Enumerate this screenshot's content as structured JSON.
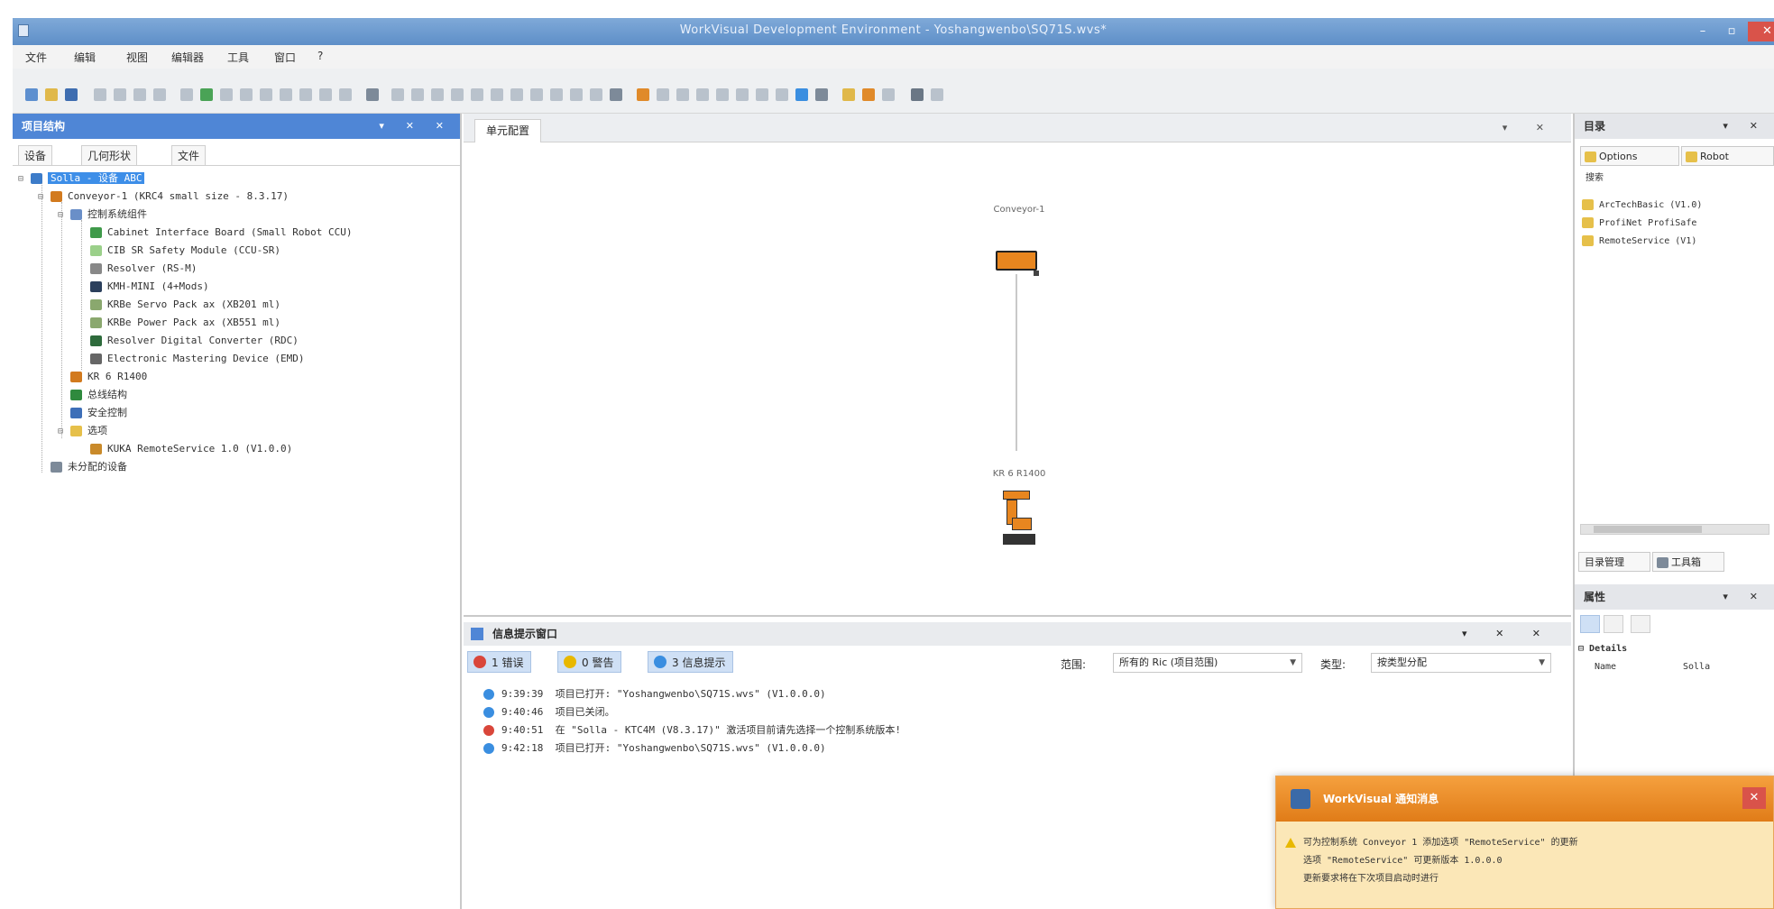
{
  "window": {
    "title": "WorkVisual Development Environment - Yoshangwenbo\\SQ71S.wvs*",
    "controls": [
      "–",
      "▫",
      "✕"
    ]
  },
  "menu": [
    "文件",
    "编辑",
    "视图",
    "编辑器",
    "工具",
    "窗口",
    "?"
  ],
  "project_panel": {
    "title": "项目结构",
    "controls": "▾ ✕ ✕",
    "tabs": [
      "设备",
      "几何形状",
      "文件"
    ],
    "tree": [
      {
        "label": "Solla - 设备 ABC",
        "icon_color": "#3d7cc9"
      },
      {
        "label": "Conveyor-1 (KRC4 small size - 8.3.17)",
        "icon_color": "#d27a1e"
      },
      {
        "label": "控制系统组件",
        "icon_color": "#6a8fc8"
      },
      {
        "label": "Cabinet Interface Board (Small Robot CCU)",
        "icon_color": "#3f9a4a"
      },
      {
        "label": "CIB SR Safety Module (CCU-SR)",
        "icon_color": "#9bd08a"
      },
      {
        "label": "Resolver (RS-M)",
        "icon_color": "#888888"
      },
      {
        "label": "KMH-MINI (4+Mods)",
        "icon_color": "#2b3f5c"
      },
      {
        "label": "KRBe Servo Pack ax (XB201 ml)",
        "icon_color": "#8aa86e"
      },
      {
        "label": "KRBe Power Pack ax (XB551 ml)",
        "icon_color": "#8aa86e"
      },
      {
        "label": "Resolver Digital Converter (RDC)",
        "icon_color": "#2e6b3c"
      },
      {
        "label": "Electronic Mastering Device (EMD)",
        "icon_color": "#666666"
      },
      {
        "label": "KR 6 R1400",
        "icon_color": "#d27a1e"
      },
      {
        "label": "总线结构",
        "icon_color": "#2f8a3e"
      },
      {
        "label": "安全控制",
        "icon_color": "#3d6fb8"
      },
      {
        "label": "选项",
        "icon_color": "#e6c04a"
      },
      {
        "label": "KUKA RemoteService 1.0 (V1.0.0)",
        "icon_color": "#c98a2a"
      },
      {
        "label": "未分配的设备",
        "icon_color": "#7d8a99"
      }
    ]
  },
  "diagram": {
    "tab_label": "单元配置",
    "controls": "▾ ✕",
    "controller_label": "Conveyor-1",
    "robot_label": "KR 6 R1400"
  },
  "messages": {
    "title": "信息提示窗口",
    "controls": "▾ ✕ ✕",
    "filters": [
      {
        "label": "1 错误",
        "color": "#d9463a"
      },
      {
        "label": "0 警告",
        "color": "#e8b800"
      },
      {
        "label": "3 信息提示",
        "color": "#3a8ee0"
      }
    ],
    "source_label": "范围:",
    "source_value": "所有的 Ric (项目范围)",
    "sort_label": "类型:",
    "sort_value": "按类型分配",
    "rows": [
      {
        "time": "9:39:39",
        "text": "项目已打开: \"Yoshangwenbo\\SQ71S.wvs\" (V1.0.0.0)",
        "type": "info",
        "color": "#3a8ee0"
      },
      {
        "time": "9:40:46",
        "text": "项目已关闭。",
        "type": "info",
        "color": "#3a8ee0"
      },
      {
        "time": "9:40:51",
        "text": "在 \"Solla - KTC4M (V8.3.17)\" 激活项目前请先选择一个控制系统版本!",
        "type": "error",
        "color": "#d9463a"
      },
      {
        "time": "9:42:18",
        "text": "项目已打开: \"Yoshangwenbo\\SQ71S.wvs\" (V1.0.0.0)",
        "type": "info",
        "color": "#3a8ee0"
      }
    ]
  },
  "catalog_panel": {
    "title": "目录",
    "controls": "▾ ✕",
    "tabs": [
      "Options",
      "Robot"
    ],
    "search_label": "搜索",
    "items": [
      "ArcTechBasic (V1.0)",
      "ProfiNet ProfiSafe",
      "RemoteService (V1)"
    ],
    "bottom_tabs": [
      "目录管理",
      "工具箱"
    ]
  },
  "properties_panel": {
    "title": "属性",
    "controls": "▾ ✕",
    "section": "Details",
    "name_key": "Name",
    "name_value": "Solla"
  },
  "notification": {
    "title": "WorkVisual 通知消息",
    "lines": [
      "可为控制系统 Conveyor 1 添加选项 \"RemoteService\" 的更新",
      "选项 \"RemoteService\" 可更新版本 1.0.0.0",
      "更新要求将在下次项目启动时进行"
    ]
  }
}
